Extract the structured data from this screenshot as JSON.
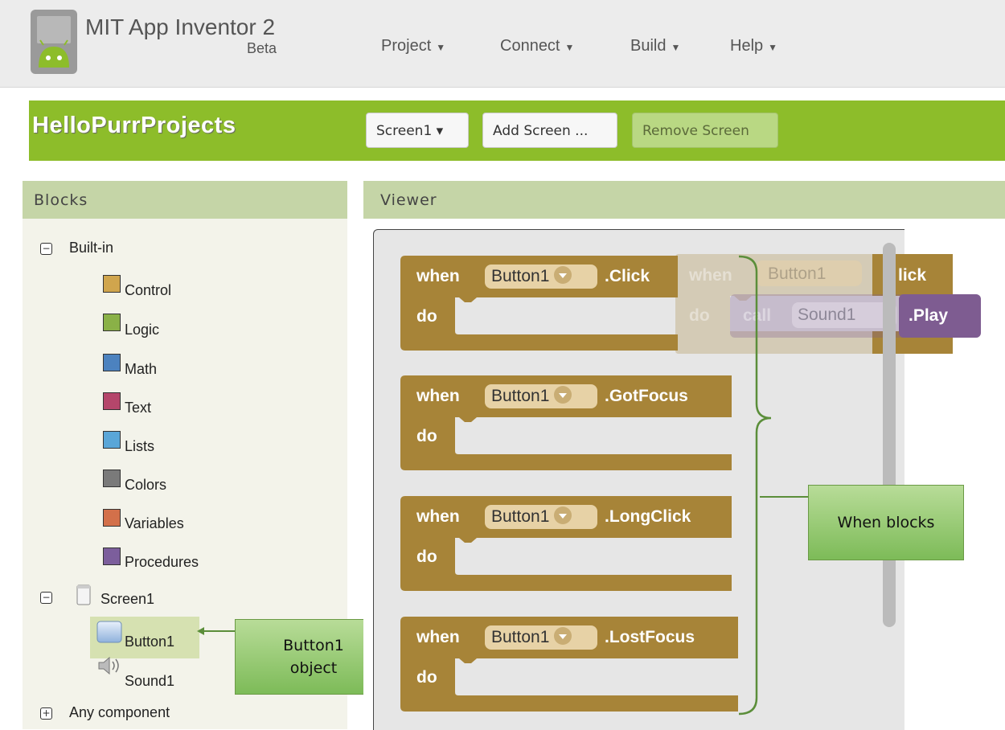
{
  "app": {
    "title": "MIT App Inventor 2",
    "badge": "Beta"
  },
  "menu": [
    {
      "label": "Project",
      "caret": "▼"
    },
    {
      "label": "Connect",
      "caret": "▼"
    },
    {
      "label": "Build",
      "caret": "▼"
    },
    {
      "label": "Help",
      "caret": "▼"
    }
  ],
  "project": {
    "name": "HelloPurrProjects",
    "screen_select": "Screen1 ▾",
    "add_screen": "Add Screen ...",
    "remove_screen": "Remove Screen"
  },
  "blocks_panel": {
    "title": "Blocks",
    "builtin_label": "Built-in",
    "builtin_items": [
      {
        "label": "Control",
        "color": "#d0a54d"
      },
      {
        "label": "Logic",
        "color": "#8ab147"
      },
      {
        "label": "Math",
        "color": "#4c82bf"
      },
      {
        "label": "Text",
        "color": "#b5466b"
      },
      {
        "label": "Lists",
        "color": "#5aa6d8"
      },
      {
        "label": "Colors",
        "color": "#7a7a7a"
      },
      {
        "label": "Variables",
        "color": "#d3704a"
      },
      {
        "label": "Procedures",
        "color": "#7c5e9c"
      }
    ],
    "screen_label": "Screen1",
    "components": [
      {
        "label": "Button1",
        "icon": "button-icon"
      },
      {
        "label": "Sound1",
        "icon": "speaker-icon"
      }
    ],
    "any_component": "Any component"
  },
  "viewer": {
    "title": "Viewer",
    "blocks": [
      {
        "when": "when",
        "component": "Button1",
        "event": ".Click",
        "do": "do"
      },
      {
        "when": "when",
        "component": "Button1",
        "event": ".GotFocus",
        "do": "do"
      },
      {
        "when": "when",
        "component": "Button1",
        "event": ".LongClick",
        "do": "do"
      },
      {
        "when": "when",
        "component": "Button1",
        "event": ".LostFocus",
        "do": "do"
      }
    ],
    "ghost": {
      "when": "when",
      "component": "Button1",
      "event_partial": "lick",
      "do": "do",
      "call": "call",
      "call_component": "Sound1",
      "method": ".Play"
    }
  },
  "annotations": {
    "when_blocks": "When blocks",
    "button1_object": "Button1\nobject"
  },
  "colors": {
    "green_bar": "#8dbd2a",
    "panel_header": "#c5d5a7",
    "event_block": "#a78438",
    "ghost_purple": "#7e5c91",
    "callout_green": "#8fc56a"
  }
}
